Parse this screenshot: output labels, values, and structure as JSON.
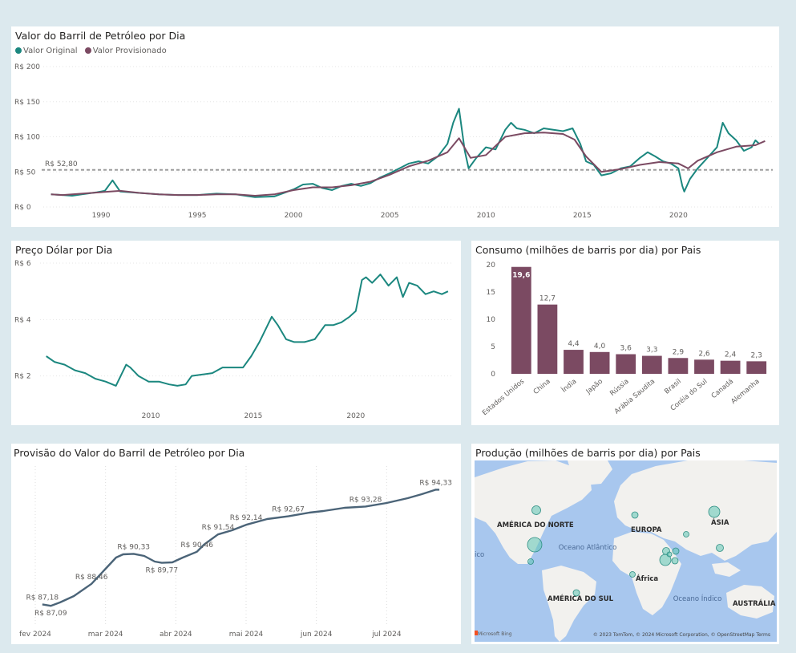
{
  "colors": {
    "background": "#dce9ee",
    "teal": "#1b877f",
    "plum": "#7b4a62",
    "provision_line": "#4b6478",
    "reference": "#9d9d9d",
    "map_ocean": "#a8c7ee",
    "map_land": "#f2f1ee",
    "bubble": "#5fc4b4"
  },
  "chart_data": [
    {
      "id": "barrel",
      "type": "line",
      "title": "Valor do Barril de Petróleo por Dia",
      "legend": {
        "position": "top-left",
        "entries": [
          "Valor Original",
          "Valor Provisionado"
        ]
      },
      "y_ticks": [
        "R$ 200",
        "R$ 150",
        "R$ 100",
        "R$ 50",
        "R$ 0"
      ],
      "x_ticks": [
        "1990",
        "1995",
        "2000",
        "2005",
        "2010",
        "2015",
        "2020"
      ],
      "ylim": [
        0,
        200
      ],
      "xlim": [
        1987.0,
        2024.9
      ],
      "reference_line": {
        "label": "R$ 52,80",
        "value": 52.8
      },
      "series": [
        {
          "name": "Valor Original",
          "x": [
            1987.4,
            1988,
            1988.5,
            1989,
            1989.8,
            1990.2,
            1990.6,
            1991,
            1992,
            1993,
            1994,
            1995,
            1996,
            1997,
            1998,
            1999,
            1999.5,
            2000,
            2000.5,
            2001,
            2001.5,
            2002,
            2002.5,
            2003,
            2003.5,
            2004,
            2004.5,
            2005,
            2005.5,
            2006,
            2006.5,
            2007,
            2007.5,
            2008,
            2008.3,
            2008.6,
            2008.9,
            2009.1,
            2009.5,
            2010,
            2010.5,
            2011,
            2011.3,
            2011.6,
            2012,
            2012.5,
            2013,
            2013.5,
            2014,
            2014.5,
            2014.9,
            2015.2,
            2015.6,
            2016,
            2016.5,
            2017,
            2017.5,
            2018,
            2018.4,
            2018.8,
            2019.2,
            2019.6,
            2020,
            2020.2,
            2020.3,
            2020.6,
            2021,
            2021.5,
            2022,
            2022.3,
            2022.6,
            2023,
            2023.4,
            2023.8,
            2024.0,
            2024.2
          ],
          "y": [
            18,
            17,
            16,
            18,
            21,
            23,
            38,
            22,
            20,
            18,
            17,
            17,
            19,
            18,
            14,
            15,
            20,
            25,
            32,
            33,
            27,
            24,
            30,
            33,
            30,
            34,
            42,
            48,
            55,
            62,
            65,
            62,
            72,
            90,
            120,
            140,
            80,
            55,
            70,
            85,
            82,
            110,
            120,
            112,
            110,
            105,
            112,
            110,
            108,
            112,
            90,
            65,
            60,
            45,
            48,
            55,
            58,
            70,
            78,
            72,
            65,
            62,
            55,
            30,
            22,
            40,
            55,
            70,
            85,
            120,
            105,
            95,
            80,
            85,
            95,
            90
          ]
        },
        {
          "name": "Valor Provisionado",
          "x": [
            1987.4,
            1988,
            1989,
            1990,
            1991,
            1992,
            1993,
            1994,
            1995,
            1996,
            1997,
            1998,
            1999,
            2000,
            2001,
            2002,
            2003,
            2004,
            2005,
            2006,
            2007,
            2008,
            2008.6,
            2009.2,
            2010,
            2011,
            2012,
            2013,
            2014,
            2014.6,
            2015.2,
            2016,
            2017,
            2018,
            2019,
            2020,
            2020.5,
            2021,
            2022,
            2023,
            2024.0,
            2024.5
          ],
          "y": [
            18,
            17,
            19,
            21,
            23,
            20,
            18,
            17,
            17,
            18,
            18,
            16,
            18,
            24,
            28,
            28,
            31,
            36,
            46,
            58,
            66,
            78,
            98,
            70,
            74,
            100,
            105,
            106,
            104,
            96,
            72,
            50,
            54,
            60,
            64,
            62,
            55,
            66,
            78,
            86,
            88,
            94
          ]
        }
      ]
    },
    {
      "id": "dollar",
      "type": "line",
      "title": "Preço Dólar por Dia",
      "y_ticks": [
        "R$ 6",
        "R$ 4",
        "R$ 2"
      ],
      "x_ticks": [
        "2010",
        "2015",
        "2020"
      ],
      "ylim": [
        1.25,
        6.0
      ],
      "xlim": [
        2004.6,
        2024.7
      ],
      "series": [
        {
          "name": "Preço Dólar",
          "x": [
            2004.9,
            2005.3,
            2005.8,
            2006.3,
            2006.8,
            2007.3,
            2007.8,
            2008.3,
            2008.6,
            2008.8,
            2009.0,
            2009.4,
            2009.9,
            2010.4,
            2010.9,
            2011.3,
            2011.7,
            2012.0,
            2012.5,
            2013.0,
            2013.5,
            2014.0,
            2014.5,
            2014.9,
            2015.3,
            2015.7,
            2015.9,
            2016.2,
            2016.6,
            2017.0,
            2017.5,
            2018.0,
            2018.5,
            2018.9,
            2019.3,
            2019.7,
            2020.0,
            2020.3,
            2020.5,
            2020.8,
            2021.2,
            2021.6,
            2022.0,
            2022.3,
            2022.6,
            2023.0,
            2023.4,
            2023.8,
            2024.2,
            2024.5
          ],
          "y": [
            2.7,
            2.5,
            2.4,
            2.2,
            2.1,
            1.9,
            1.8,
            1.65,
            2.1,
            2.4,
            2.3,
            2.0,
            1.8,
            1.8,
            1.7,
            1.65,
            1.7,
            2.0,
            2.05,
            2.1,
            2.3,
            2.3,
            2.3,
            2.7,
            3.2,
            3.8,
            4.1,
            3.8,
            3.3,
            3.2,
            3.2,
            3.3,
            3.8,
            3.8,
            3.9,
            4.1,
            4.3,
            5.4,
            5.5,
            5.3,
            5.6,
            5.2,
            5.5,
            4.8,
            5.3,
            5.2,
            4.9,
            5.0,
            4.9,
            5.0
          ]
        }
      ]
    },
    {
      "id": "consumo",
      "type": "bar",
      "title": "Consumo (milhões de barris por dia) por Pais",
      "categories": [
        "Estados Unidos",
        "China",
        "Índia",
        "Japão",
        "Rússia",
        "Arábia Saudita",
        "Brasil",
        "Coréia do Sul",
        "Canadá",
        "Alemanha"
      ],
      "values": [
        19.6,
        12.7,
        4.4,
        4.0,
        3.6,
        3.3,
        2.9,
        2.6,
        2.4,
        2.3
      ],
      "value_labels": [
        "19,6",
        "12,7",
        "4,4",
        "4,0",
        "3,6",
        "3,3",
        "2,9",
        "2,6",
        "2,4",
        "2,3"
      ],
      "y_ticks": [
        "20",
        "15",
        "10",
        "5",
        "0"
      ],
      "ylim": [
        0,
        20
      ]
    },
    {
      "id": "provisao",
      "type": "line",
      "title": "Provisão do Valor do Barril de Petróleo por Dia",
      "x_ticks": [
        "fev 2024",
        "mar 2024",
        "abr 2024",
        "mai 2024",
        "jun 2024",
        "jul 2024"
      ],
      "xlim": [
        0.0,
        6.0
      ],
      "ylim": [
        86.3,
        94.8
      ],
      "series": [
        {
          "name": "Provisão",
          "x": [
            0.1,
            0.22,
            0.35,
            0.55,
            0.8,
            1.0,
            1.15,
            1.25,
            1.4,
            1.55,
            1.7,
            1.8,
            1.95,
            2.1,
            2.3,
            2.4,
            2.6,
            2.8,
            3.0,
            3.3,
            3.6,
            3.9,
            4.1,
            4.4,
            4.7,
            5.0,
            5.3,
            5.5,
            5.7,
            5.75
          ],
          "y": [
            87.18,
            87.09,
            87.3,
            87.7,
            88.46,
            89.4,
            90.1,
            90.3,
            90.33,
            90.2,
            89.85,
            89.77,
            89.8,
            90.1,
            90.46,
            90.9,
            91.54,
            91.8,
            92.14,
            92.5,
            92.67,
            92.9,
            93.0,
            93.2,
            93.28,
            93.5,
            93.8,
            94.05,
            94.33,
            94.33
          ]
        }
      ],
      "annotations": [
        {
          "label": "R$ 87,18",
          "x": 0.1,
          "y": 87.18
        },
        {
          "label": "R$ 87,09",
          "x": 0.22,
          "y": 87.09
        },
        {
          "label": "R$ 88,46",
          "x": 0.8,
          "y": 88.46
        },
        {
          "label": "R$ 90,33",
          "x": 1.4,
          "y": 90.33
        },
        {
          "label": "R$ 89,77",
          "x": 1.8,
          "y": 89.77
        },
        {
          "label": "R$ 90,46",
          "x": 2.3,
          "y": 90.46
        },
        {
          "label": "R$ 91,54",
          "x": 2.6,
          "y": 91.54
        },
        {
          "label": "R$ 92,14",
          "x": 3.0,
          "y": 92.14
        },
        {
          "label": "R$ 92,67",
          "x": 3.6,
          "y": 92.67
        },
        {
          "label": "R$ 93,28",
          "x": 4.7,
          "y": 93.28
        },
        {
          "label": "R$ 94,33",
          "x": 5.7,
          "y": 94.33
        }
      ]
    }
  ],
  "map": {
    "title": "Produção (milhões de barris por dia) por Pais",
    "labels": [
      "AMÉRICA DO NORTE",
      "EUROPA",
      "ÁSIA",
      "África",
      "AMÉRICA DO SUL",
      "AUSTRÁLIA"
    ],
    "oceans": [
      "Oceano Atlântico",
      "Oceano Índico"
    ],
    "attribution": "© 2023 TomTom, © 2024 Microsoft Corporation, © OpenStreetMap  Terms",
    "bing": "Microsoft Bing",
    "edge_text": "ico"
  }
}
